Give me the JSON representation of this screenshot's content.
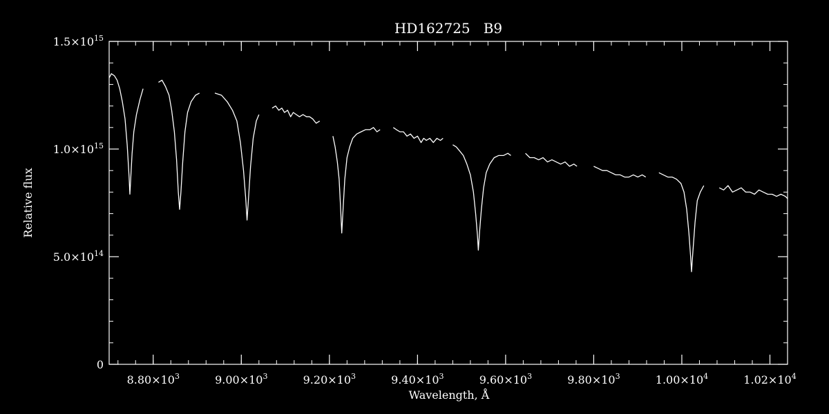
{
  "chart_data": {
    "type": "line",
    "title": "HD162725   B9",
    "xlabel": "Wavelength, Å",
    "ylabel": "Relative flux",
    "xlim": [
      8700,
      10240
    ],
    "ylim": [
      0,
      1500000000000000.0
    ],
    "grid": false,
    "legend": "none",
    "colors": {
      "background": "#000000",
      "foreground": "#ffffff"
    },
    "x_ticks": [
      {
        "value": 8800,
        "mantissa": "8.80",
        "exp": "3"
      },
      {
        "value": 9000,
        "mantissa": "9.00",
        "exp": "3"
      },
      {
        "value": 9200,
        "mantissa": "9.20",
        "exp": "3"
      },
      {
        "value": 9400,
        "mantissa": "9.40",
        "exp": "3"
      },
      {
        "value": 9600,
        "mantissa": "9.60",
        "exp": "3"
      },
      {
        "value": 9800,
        "mantissa": "9.80",
        "exp": "3"
      },
      {
        "value": 10000,
        "mantissa": "1.00",
        "exp": "4"
      },
      {
        "value": 10200,
        "mantissa": "1.02",
        "exp": "4"
      }
    ],
    "x_minor_step": 40,
    "y_ticks": [
      {
        "value": 0,
        "mantissa": "0",
        "exp": ""
      },
      {
        "value": 500000000000000.0,
        "mantissa": "5.0",
        "exp": "14"
      },
      {
        "value": 1000000000000000.0,
        "mantissa": "1.0",
        "exp": "15"
      },
      {
        "value": 1500000000000000.0,
        "mantissa": "1.5",
        "exp": "15"
      }
    ],
    "y_minor_step": 100000000000000.0,
    "series": [
      {
        "segments": [
          [
            8700,
            1330000000000000.0
          ],
          [
            8705,
            1350000000000000.0
          ],
          [
            8712,
            1340000000000000.0
          ],
          [
            8718,
            1320000000000000.0
          ],
          [
            8724,
            1280000000000000.0
          ],
          [
            8730,
            1220000000000000.0
          ],
          [
            8736,
            1140000000000000.0
          ],
          [
            8741,
            1020000000000000.0
          ],
          [
            8745,
            880000000000000.0
          ],
          [
            8747,
            790000000000000.0
          ],
          [
            8749,
            860000000000000.0
          ],
          [
            8752,
            980000000000000.0
          ],
          [
            8756,
            1080000000000000.0
          ],
          [
            8762,
            1160000000000000.0
          ],
          [
            8770,
            1230000000000000.0
          ],
          [
            8777,
            1280000000000000.0
          ]
        ]
      },
      {
        "segments": [
          [
            8812,
            1310000000000000.0
          ],
          [
            8820,
            1320000000000000.0
          ],
          [
            8828,
            1290000000000000.0
          ],
          [
            8836,
            1250000000000000.0
          ],
          [
            8842,
            1180000000000000.0
          ],
          [
            8848,
            1080000000000000.0
          ],
          [
            8853,
            950000000000000.0
          ],
          [
            8857,
            800000000000000.0
          ],
          [
            8860,
            720000000000000.0
          ],
          [
            8863,
            800000000000000.0
          ],
          [
            8867,
            940000000000000.0
          ],
          [
            8872,
            1080000000000000.0
          ],
          [
            8878,
            1170000000000000.0
          ],
          [
            8886,
            1220000000000000.0
          ],
          [
            8896,
            1250000000000000.0
          ],
          [
            8905,
            1260000000000000.0
          ]
        ]
      },
      {
        "segments": [
          [
            8940,
            1260000000000000.0
          ],
          [
            8955,
            1250000000000000.0
          ],
          [
            8968,
            1220000000000000.0
          ],
          [
            8980,
            1180000000000000.0
          ],
          [
            8990,
            1130000000000000.0
          ],
          [
            8998,
            1030000000000000.0
          ],
          [
            9005,
            900000000000000.0
          ],
          [
            9010,
            770000000000000.0
          ],
          [
            9013,
            670000000000000.0
          ],
          [
            9016,
            760000000000000.0
          ],
          [
            9021,
            920000000000000.0
          ],
          [
            9027,
            1050000000000000.0
          ],
          [
            9034,
            1130000000000000.0
          ],
          [
            9040,
            1160000000000000.0
          ]
        ]
      },
      {
        "segments": [
          [
            9070,
            1190000000000000.0
          ],
          [
            9078,
            1200000000000000.0
          ],
          [
            9085,
            1180000000000000.0
          ],
          [
            9092,
            1190000000000000.0
          ],
          [
            9098,
            1170000000000000.0
          ],
          [
            9105,
            1180000000000000.0
          ],
          [
            9112,
            1150000000000000.0
          ],
          [
            9118,
            1170000000000000.0
          ],
          [
            9125,
            1160000000000000.0
          ],
          [
            9132,
            1150000000000000.0
          ],
          [
            9140,
            1160000000000000.0
          ],
          [
            9148,
            1150000000000000.0
          ],
          [
            9155,
            1150000000000000.0
          ],
          [
            9162,
            1140000000000000.0
          ],
          [
            9170,
            1120000000000000.0
          ],
          [
            9178,
            1130000000000000.0
          ]
        ]
      },
      {
        "segments": [
          [
            9208,
            1060000000000000.0
          ],
          [
            9213,
            1010000000000000.0
          ],
          [
            9218,
            940000000000000.0
          ],
          [
            9222,
            860000000000000.0
          ],
          [
            9225,
            740000000000000.0
          ],
          [
            9228,
            610000000000000.0
          ],
          [
            9231,
            720000000000000.0
          ],
          [
            9235,
            860000000000000.0
          ],
          [
            9240,
            960000000000000.0
          ],
          [
            9246,
            1010000000000000.0
          ],
          [
            9253,
            1050000000000000.0
          ],
          [
            9262,
            1070000000000000.0
          ],
          [
            9272,
            1080000000000000.0
          ],
          [
            9282,
            1090000000000000.0
          ],
          [
            9292,
            1090000000000000.0
          ],
          [
            9300,
            1100000000000000.0
          ],
          [
            9308,
            1080000000000000.0
          ],
          [
            9315,
            1090000000000000.0
          ]
        ]
      },
      {
        "segments": [
          [
            9345,
            1100000000000000.0
          ],
          [
            9352,
            1090000000000000.0
          ],
          [
            9360,
            1080000000000000.0
          ],
          [
            9368,
            1080000000000000.0
          ],
          [
            9376,
            1060000000000000.0
          ],
          [
            9384,
            1070000000000000.0
          ],
          [
            9392,
            1050000000000000.0
          ],
          [
            9400,
            1060000000000000.0
          ],
          [
            9408,
            1030000000000000.0
          ],
          [
            9414,
            1050000000000000.0
          ],
          [
            9420,
            1040000000000000.0
          ],
          [
            9428,
            1050000000000000.0
          ],
          [
            9436,
            1030000000000000.0
          ],
          [
            9444,
            1050000000000000.0
          ],
          [
            9452,
            1040000000000000.0
          ],
          [
            9458,
            1050000000000000.0
          ]
        ]
      },
      {
        "segments": [
          [
            9480,
            1020000000000000.0
          ],
          [
            9488,
            1010000000000000.0
          ],
          [
            9496,
            990000000000000.0
          ],
          [
            9504,
            970000000000000.0
          ],
          [
            9512,
            930000000000000.0
          ],
          [
            9520,
            880000000000000.0
          ],
          [
            9527,
            800000000000000.0
          ],
          [
            9532,
            700000000000000.0
          ],
          [
            9536,
            600000000000000.0
          ],
          [
            9538,
            530000000000000.0
          ],
          [
            9541,
            620000000000000.0
          ],
          [
            9545,
            720000000000000.0
          ],
          [
            9550,
            820000000000000.0
          ],
          [
            9556,
            890000000000000.0
          ],
          [
            9564,
            930000000000000.0
          ],
          [
            9574,
            960000000000000.0
          ],
          [
            9584,
            970000000000000.0
          ],
          [
            9595,
            970000000000000.0
          ],
          [
            9605,
            980000000000000.0
          ],
          [
            9612,
            970000000000000.0
          ]
        ]
      },
      {
        "segments": [
          [
            9645,
            980000000000000.0
          ],
          [
            9655,
            960000000000000.0
          ],
          [
            9665,
            960000000000000.0
          ],
          [
            9675,
            950000000000000.0
          ],
          [
            9685,
            960000000000000.0
          ],
          [
            9695,
            940000000000000.0
          ],
          [
            9705,
            950000000000000.0
          ],
          [
            9715,
            940000000000000.0
          ],
          [
            9725,
            930000000000000.0
          ],
          [
            9735,
            940000000000000.0
          ],
          [
            9745,
            920000000000000.0
          ],
          [
            9755,
            930000000000000.0
          ],
          [
            9762,
            920000000000000.0
          ]
        ]
      },
      {
        "segments": [
          [
            9800,
            920000000000000.0
          ],
          [
            9810,
            910000000000000.0
          ],
          [
            9820,
            900000000000000.0
          ],
          [
            9830,
            900000000000000.0
          ],
          [
            9840,
            890000000000000.0
          ],
          [
            9850,
            880000000000000.0
          ],
          [
            9860,
            880000000000000.0
          ],
          [
            9870,
            870000000000000.0
          ],
          [
            9880,
            870000000000000.0
          ],
          [
            9890,
            880000000000000.0
          ],
          [
            9900,
            870000000000000.0
          ],
          [
            9910,
            880000000000000.0
          ],
          [
            9918,
            870000000000000.0
          ]
        ]
      },
      {
        "segments": [
          [
            9948,
            890000000000000.0
          ],
          [
            9958,
            880000000000000.0
          ],
          [
            9968,
            870000000000000.0
          ],
          [
            9978,
            870000000000000.0
          ],
          [
            9988,
            860000000000000.0
          ],
          [
            9998,
            840000000000000.0
          ],
          [
            10005,
            800000000000000.0
          ],
          [
            10011,
            720000000000000.0
          ],
          [
            10016,
            610000000000000.0
          ],
          [
            10020,
            500000000000000.0
          ],
          [
            10022,
            430000000000000.0
          ],
          [
            10025,
            520000000000000.0
          ],
          [
            10030,
            660000000000000.0
          ],
          [
            10035,
            760000000000000.0
          ],
          [
            10042,
            800000000000000.0
          ],
          [
            10050,
            830000000000000.0
          ]
        ]
      },
      {
        "segments": [
          [
            10085,
            820000000000000.0
          ],
          [
            10095,
            810000000000000.0
          ],
          [
            10105,
            830000000000000.0
          ],
          [
            10115,
            800000000000000.0
          ],
          [
            10125,
            810000000000000.0
          ],
          [
            10135,
            820000000000000.0
          ],
          [
            10145,
            800000000000000.0
          ],
          [
            10155,
            800000000000000.0
          ],
          [
            10165,
            790000000000000.0
          ],
          [
            10175,
            810000000000000.0
          ],
          [
            10185,
            800000000000000.0
          ],
          [
            10195,
            790000000000000.0
          ],
          [
            10205,
            790000000000000.0
          ],
          [
            10215,
            780000000000000.0
          ],
          [
            10225,
            790000000000000.0
          ],
          [
            10235,
            780000000000000.0
          ],
          [
            10240,
            770000000000000.0
          ]
        ]
      }
    ]
  }
}
